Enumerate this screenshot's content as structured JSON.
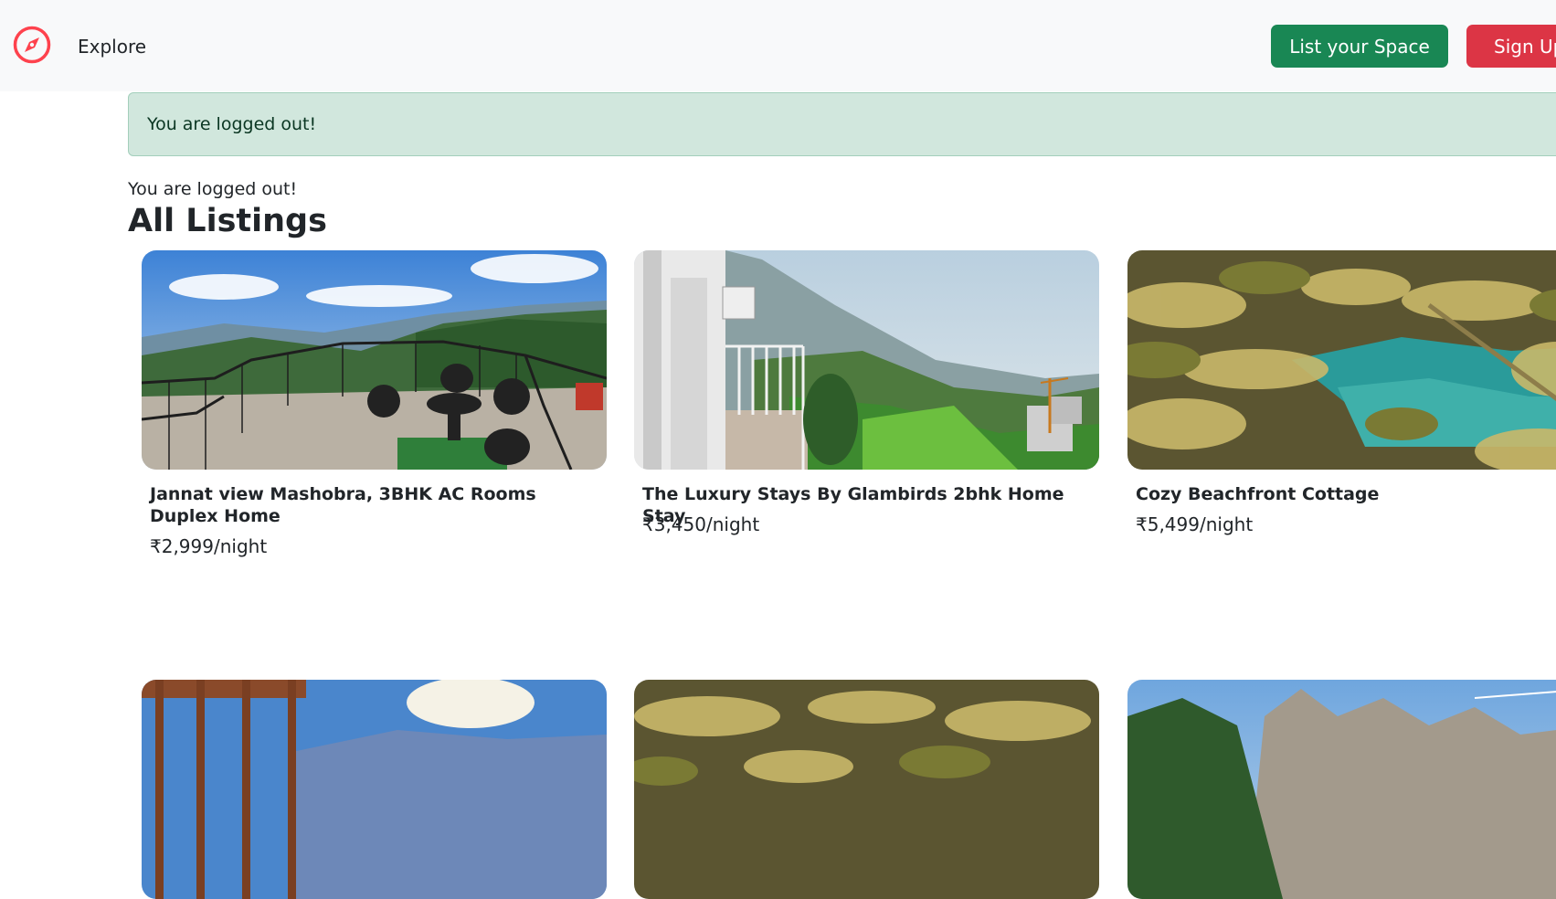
{
  "navbar": {
    "brand_icon": "compass-icon",
    "explore_label": "Explore",
    "list_space_label": "List your Space",
    "signup_label": "Sign Up",
    "colors": {
      "brand": "#fe424d",
      "list_button": "#198754",
      "signup_button": "#dc3545"
    }
  },
  "alert": {
    "message": "You are logged out!"
  },
  "flash_text": "You are logged out!",
  "page_title": "All Listings",
  "listings": [
    {
      "title": "Jannat view Mashobra, 3BHK AC Rooms Duplex Home",
      "price": "₹2,999/night"
    },
    {
      "title": "The Luxury Stays By Glambirds 2bhk Home Stay",
      "price": "₹3,450/night"
    },
    {
      "title": "Cozy Beachfront Cottage",
      "price": "₹5,499/night"
    }
  ]
}
